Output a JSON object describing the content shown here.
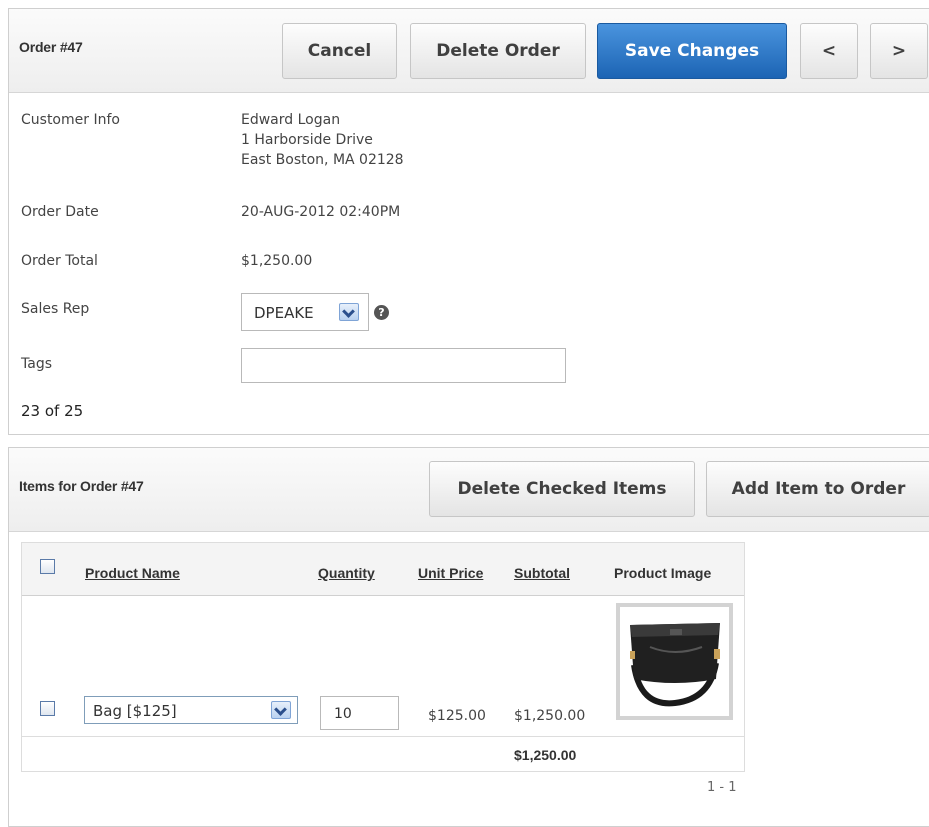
{
  "order": {
    "title": "Order #47",
    "buttons": {
      "cancel": "Cancel",
      "delete": "Delete Order",
      "save": "Save Changes",
      "prev": "<",
      "next": ">"
    },
    "customer_label": "Customer Info",
    "customer_lines": [
      "Edward Logan",
      "1 Harborside Drive",
      "East Boston, MA 02128"
    ],
    "date_label": "Order Date",
    "date_value": "20-AUG-2012 02:40PM",
    "total_label": "Order Total",
    "total_value": "$1,250.00",
    "sales_rep_label": "Sales Rep",
    "sales_rep_value": "DPEAKE",
    "help_icon": "?",
    "tags_label": "Tags",
    "tags_value": "",
    "pagination": "23 of 25"
  },
  "items": {
    "title": "Items for Order #47",
    "buttons": {
      "delete_checked": "Delete Checked Items",
      "add_item": "Add Item to Order"
    },
    "columns": [
      "Product Name",
      "Quantity",
      "Unit Price",
      "Subtotal",
      "Product Image"
    ],
    "rows": [
      {
        "product": "Bag [$125]",
        "quantity": "10",
        "unit_price": "$125.00",
        "subtotal": "$1,250.00",
        "image_icon": "handbag-image"
      }
    ],
    "sum_total": "$1,250.00",
    "row_range": "1 - 1"
  },
  "colors": {
    "primary_button": "#1c64b4",
    "region_header": "#eeeeee",
    "border": "#cfcfcf"
  }
}
